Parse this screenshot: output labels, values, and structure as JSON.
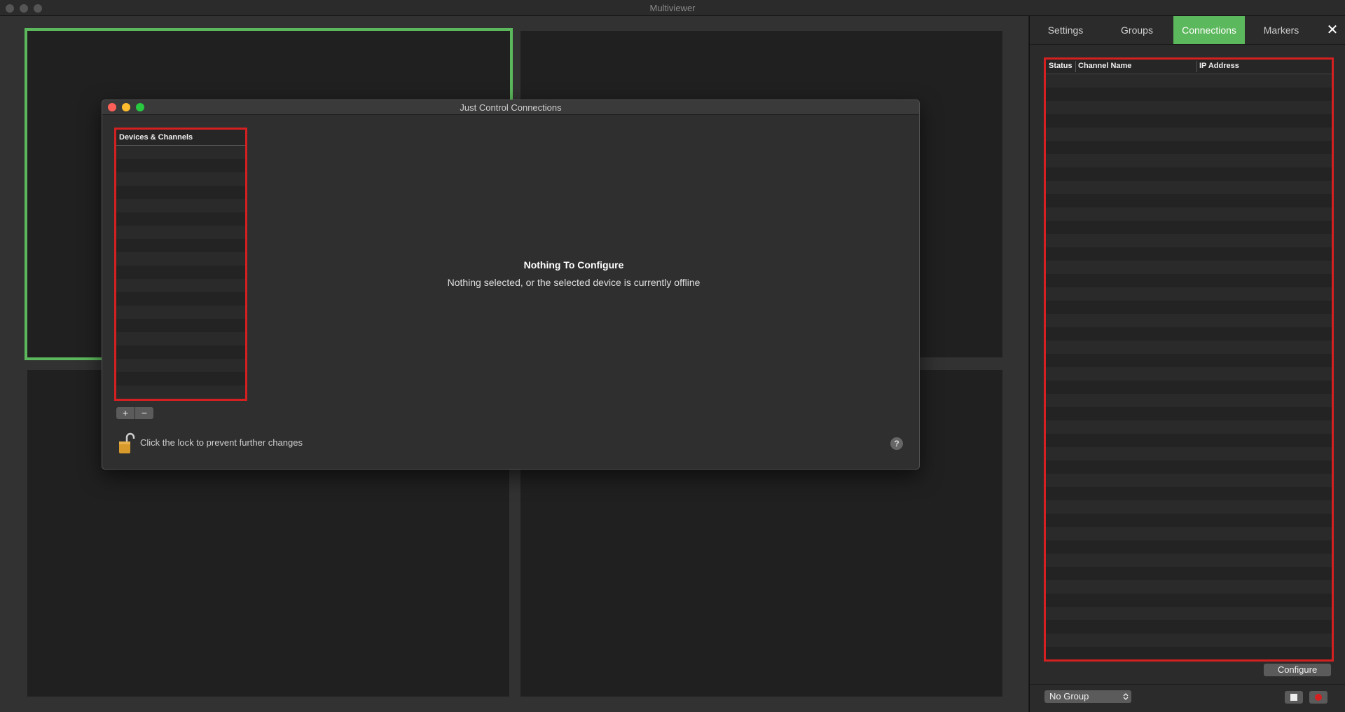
{
  "window": {
    "title": "Multiviewer"
  },
  "panel": {
    "tabs": [
      {
        "label": "Settings"
      },
      {
        "label": "Groups"
      },
      {
        "label": "Connections"
      },
      {
        "label": "Markers"
      }
    ],
    "active_tab": "Connections",
    "close_symbol": "✕",
    "table": {
      "columns": [
        "Status",
        "Channel Name",
        "IP Address"
      ]
    },
    "configure_label": "Configure",
    "group_select": {
      "value": "No Group"
    }
  },
  "dialog": {
    "title": "Just Control Connections",
    "list_header": "Devices & Channels",
    "add_symbol": "+",
    "remove_symbol": "−",
    "empty_title": "Nothing To Configure",
    "empty_subtitle": "Nothing selected, or the selected device is currently offline",
    "lock_text": "Click the lock to prevent further changes",
    "help_symbol": "?"
  },
  "colors": {
    "accent": "#5cb85c",
    "highlight_red": "#d42020",
    "close_red": "#ff5f57",
    "minimize_yellow": "#febc2e",
    "zoom_green": "#28c840",
    "lock_orange": "#d89a2b"
  },
  "icons": {
    "close": "close-icon",
    "lock": "unlocked-padlock-icon",
    "stop": "stop-square-icon",
    "record": "record-dot-icon",
    "updown": "chevron-updown-icon"
  }
}
